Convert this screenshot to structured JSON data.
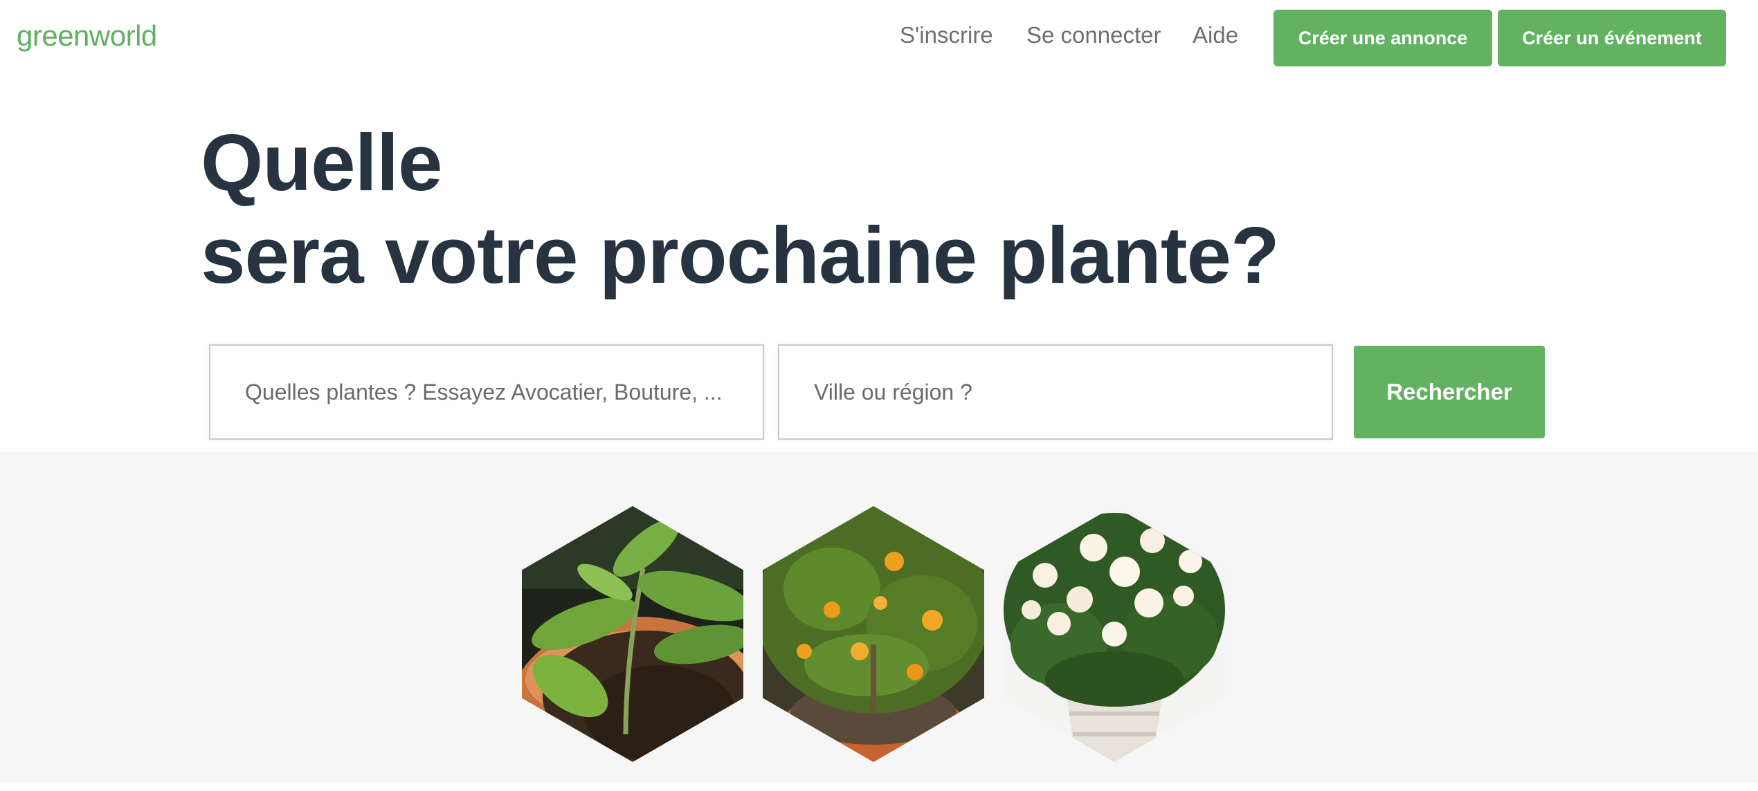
{
  "header": {
    "logo": "greenworld",
    "nav": {
      "signup": "S'inscrire",
      "login": "Se connecter",
      "help": "Aide"
    },
    "buttons": {
      "create_ad": "Créer une annonce",
      "create_event": "Créer un événement"
    }
  },
  "hero": {
    "title_line1": "Quelle",
    "title_line2": "sera votre prochaine plante?"
  },
  "search": {
    "what_placeholder": "Quelles plantes ? Essayez Avocatier, Bouture, ...",
    "where_placeholder": "Ville ou région ?",
    "submit_label": "Rechercher"
  },
  "gallery": {
    "items": [
      {
        "icon": "avocado-plant-photo"
      },
      {
        "icon": "kumquat-tree-photo"
      },
      {
        "icon": "white-roses-photo"
      }
    ]
  },
  "colors": {
    "brand_green": "#62b262",
    "title": "#273340",
    "band_bg": "#f6f6f6"
  }
}
